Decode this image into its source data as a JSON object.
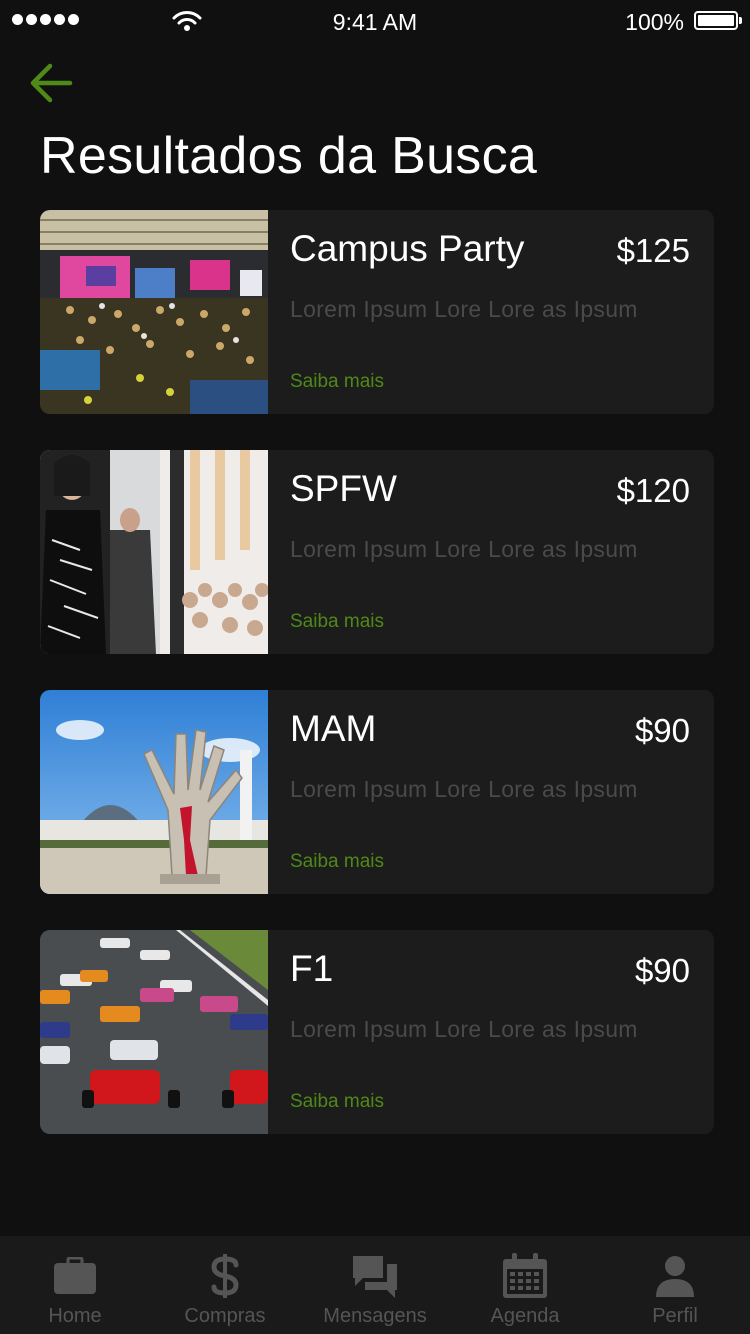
{
  "status_bar": {
    "time": "9:41 AM",
    "battery": "100%"
  },
  "header": {
    "title": "Resultados da Busca",
    "back_icon": "arrow-left-icon"
  },
  "colors": {
    "accent": "#4e8a17",
    "background": "#101010",
    "card": "#1c1c1c",
    "muted_text": "#4a4a4a",
    "tab_inactive": "#555555"
  },
  "results": [
    {
      "title": "Campus Party",
      "price": "$125",
      "description": "Lorem Ipsum Lore Lore as Ipsum",
      "link": "Saiba mais"
    },
    {
      "title": "SPFW",
      "price": "$120",
      "description": "Lorem Ipsum Lore Lore as Ipsum",
      "link": "Saiba mais"
    },
    {
      "title": "MAM",
      "price": "$90",
      "description": "Lorem Ipsum Lore Lore as Ipsum",
      "link": "Saiba mais"
    },
    {
      "title": "F1",
      "price": "$90",
      "description": "Lorem Ipsum Lore Lore as Ipsum",
      "link": "Saiba mais"
    }
  ],
  "tab_bar": [
    {
      "label": "Home",
      "icon": "briefcase-icon"
    },
    {
      "label": "Compras",
      "icon": "dollar-icon"
    },
    {
      "label": "Mensagens",
      "icon": "chat-icon"
    },
    {
      "label": "Agenda",
      "icon": "calendar-icon"
    },
    {
      "label": "Perfil",
      "icon": "person-icon"
    }
  ]
}
